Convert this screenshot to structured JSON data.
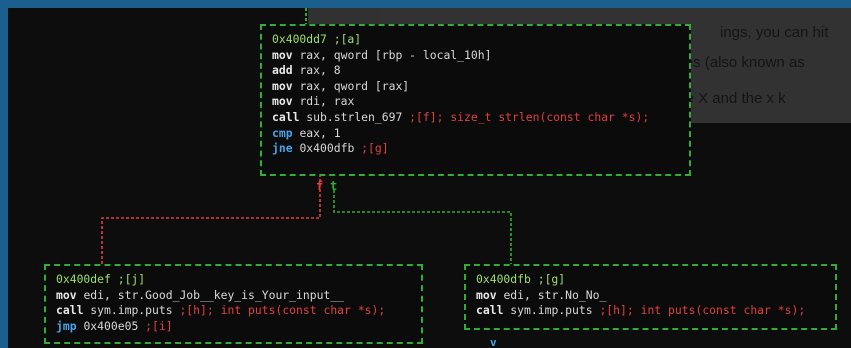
{
  "ghost_text": {
    "line1": "ings, you can hit",
    "line2": "st to go. Cross-references (also known as",
    "line3": "s are available respectively with the X and the x k"
  },
  "node_main": {
    "title": "0x400dd7 ;[a]",
    "lines": [
      {
        "mn": "mov",
        "ops": "rax, qword [rbp - local_10h]",
        "comment": ""
      },
      {
        "mn": "add",
        "ops": "rax, 8",
        "comment": ""
      },
      {
        "mn": "mov",
        "ops": "rax, qword [rax]",
        "comment": ""
      },
      {
        "mn": "mov",
        "ops": "rdi, rax",
        "comment": ""
      },
      {
        "mn": "call",
        "ops": "sub.strlen_697",
        "comment": ";[f]; size_t strlen(const char *s);"
      },
      {
        "mn": "cmp",
        "ops": "eax, 1",
        "comment": ""
      },
      {
        "mn": "jne",
        "ops": "0x400dfb",
        "comment": ";[g]"
      }
    ]
  },
  "node_left": {
    "title": "0x400def ;[j]",
    "lines": [
      {
        "mn": "mov",
        "ops": "edi, str.Good_Job__key_is_Your_input__",
        "comment": ""
      },
      {
        "mn": "call",
        "ops": "sym.imp.puts",
        "comment": ";[h]; int puts(const char *s);"
      },
      {
        "mn": "jmp",
        "ops": "0x400e05",
        "comment": ";[i]"
      }
    ]
  },
  "node_right": {
    "title": "0x400dfb ;[g]",
    "lines": [
      {
        "mn": "mov",
        "ops": "edi, str.No_No_",
        "comment": ""
      },
      {
        "mn": "call",
        "ops": "sym.imp.puts",
        "comment": ";[h]; int puts(const char *s);"
      }
    ]
  },
  "edges": {
    "false_label": "f",
    "true_label": "t",
    "bottom_marker": "v"
  },
  "colors": {
    "frame_border": "#1b5f8f",
    "background": "#0d0d0d",
    "node_border": "#2fae33",
    "edge_false": "#e04040",
    "edge_true": "#2fae33",
    "address": "#9de06a",
    "comment": "#e04040",
    "mnemonic_blue": "#4aa2e8"
  }
}
